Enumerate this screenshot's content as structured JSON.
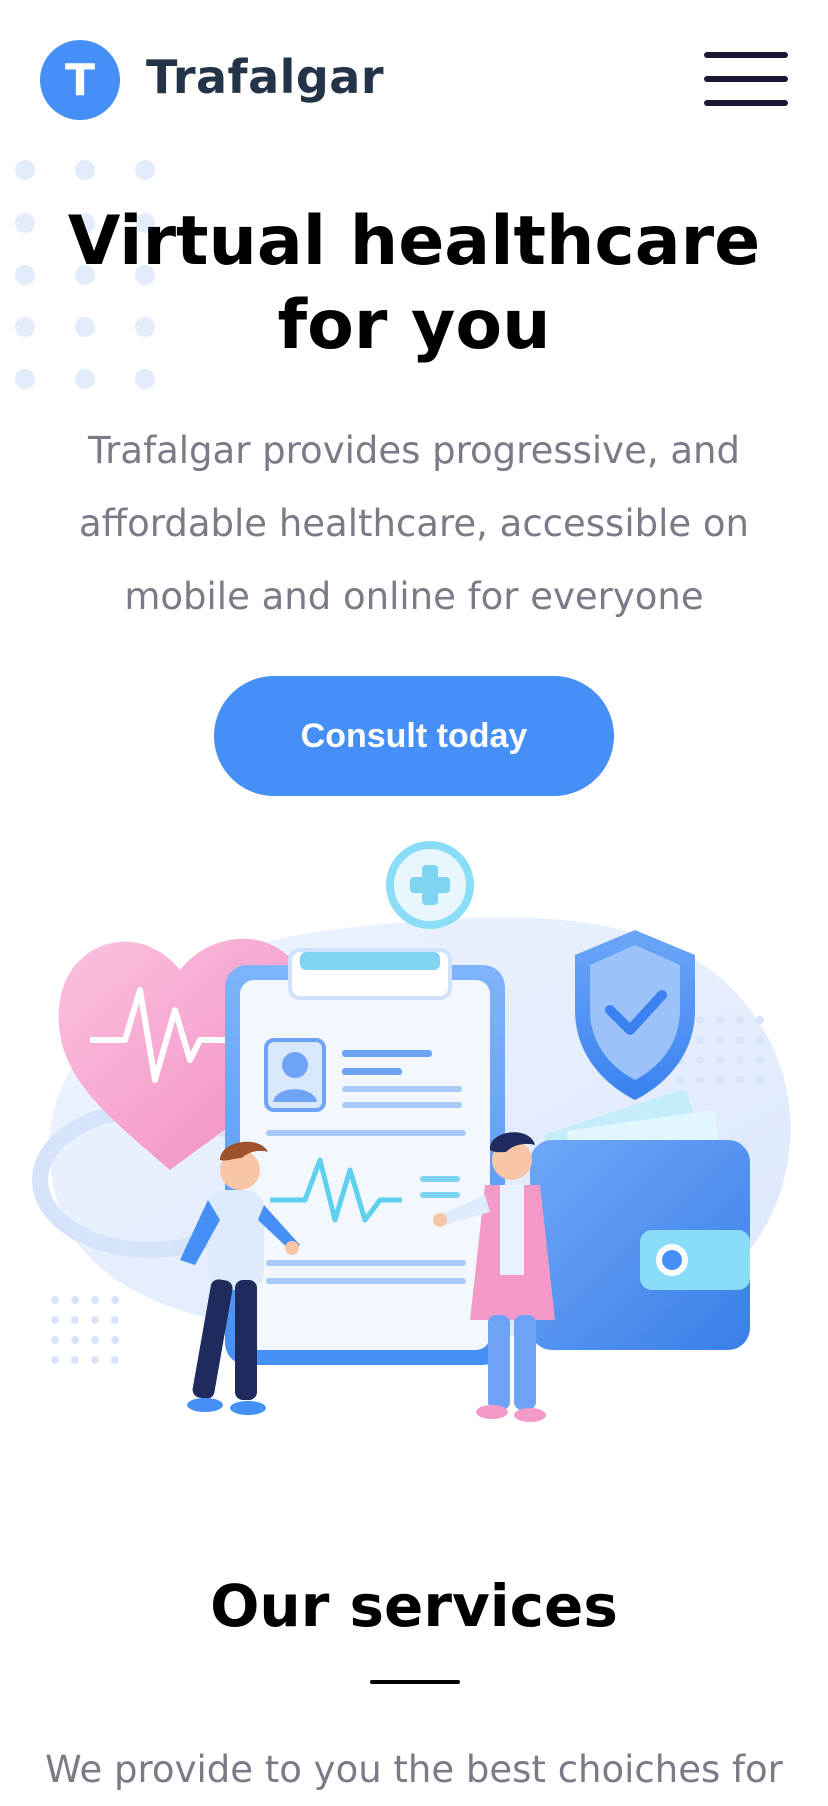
{
  "header": {
    "logo_letter": "T",
    "brand": "Trafalgar",
    "menu_icon": "hamburger-menu-icon"
  },
  "hero": {
    "title_line1": "Virtual healthcare",
    "title_line2": "for you",
    "subtitle": "Trafalgar provides progressive, and affordable healthcare, accessible on mobile and online for everyone",
    "cta_label": "Consult today"
  },
  "services": {
    "title": "Our services",
    "subtitle_partial": "We provide to you the best choiches for"
  },
  "colors": {
    "primary": "#458FF6",
    "dark_text": "#233348",
    "muted_text": "#7D7987",
    "pink": "#F49AC9"
  }
}
